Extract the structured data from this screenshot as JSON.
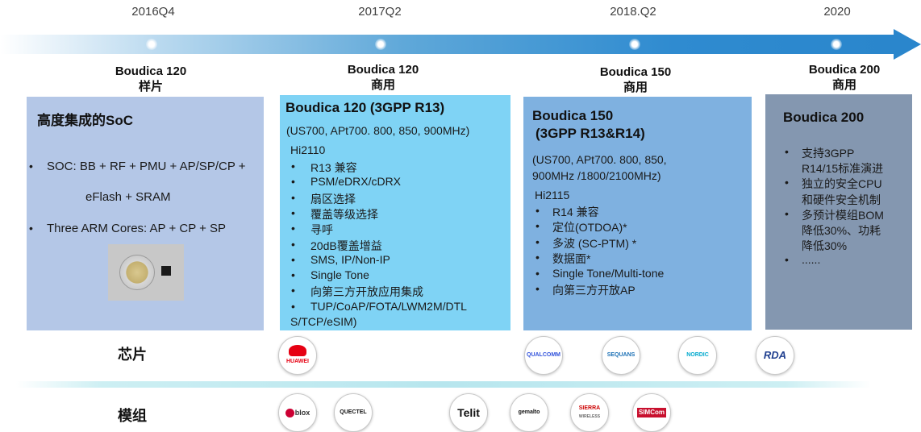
{
  "timeline": {
    "dates": [
      "2016Q4",
      "2017Q2",
      "2018.Q2",
      "2020"
    ],
    "milestones": [
      {
        "name": "Boudica 120",
        "status": "样片"
      },
      {
        "name": "Boudica 120",
        "status": "商用"
      },
      {
        "name": "Boudica 150",
        "status": "商用"
      },
      {
        "name": "Boudica 200",
        "status": "商用"
      }
    ]
  },
  "box1": {
    "title": "高度集成的SoC",
    "bullet_mark": "•",
    "line1": "SOC: BB + RF + PMU + AP/SP/CP +",
    "line2": "eFlash + SRAM",
    "line3": "Three ARM Cores: AP + CP + SP"
  },
  "box2": {
    "title": "Boudica 120 (3GPP R13)",
    "bands": "(US700, APt700. 800, 850, 900MHz)",
    "chip": "Hi2110",
    "bullet_mark": "•",
    "items": [
      "R13 兼容",
      "PSM/eDRX/cDRX",
      "扇区选择",
      "覆盖等级选择",
      "寻呼",
      "20dB覆盖增益",
      "SMS, IP/Non-IP",
      "Single Tone",
      "向第三方开放应用集成",
      "TUP/CoAP/FOTA/LWM2M/DTL"
    ],
    "item_cont": "S/TCP/eSIM)"
  },
  "box3": {
    "title_line1": "Boudica 150",
    "title_line2": "(3GPP R13&R14)",
    "bands_line1": "(US700, APt700. 800, 850,",
    "bands_line2": "900MHz /1800/2100MHz)",
    "chip": "Hi2115",
    "bullet_mark": "•",
    "items": [
      "R14 兼容",
      "定位(OTDOA)*",
      "多波 (SC-PTM) *",
      "数据面*",
      "Single Tone/Multi-tone",
      "向第三方开放AP"
    ]
  },
  "box4": {
    "title": "Boudica 200",
    "bullet_mark": "•",
    "lines": [
      {
        "b": true,
        "text": "支持3GPP"
      },
      {
        "b": false,
        "text": "R14/15标准演进"
      },
      {
        "b": true,
        "text": "独立的安全CPU"
      },
      {
        "b": false,
        "text": "和硬件安全机制"
      },
      {
        "b": true,
        "text": "多预计模组BOM"
      },
      {
        "b": false,
        "text": "降低30%、功耗"
      },
      {
        "b": false,
        "text": "降低30%"
      },
      {
        "b": true,
        "text": "......"
      }
    ]
  },
  "rows": {
    "chip_label": "芯片",
    "module_label": "模组"
  },
  "chip_logos": [
    {
      "icon": "huawei-logo",
      "text": "HUAWEI",
      "color": "#e60012"
    },
    {
      "icon": "qualcomm-logo",
      "text": "QUALCOMM",
      "color": "#3253dc"
    },
    {
      "icon": "sequans-logo",
      "text": "SEQUANS",
      "color": "#1a6fb5"
    },
    {
      "icon": "nordic-logo",
      "text": "NORDIC",
      "color": "#00a9ce"
    },
    {
      "icon": "rda-logo",
      "text": "RDA",
      "color": "#1f3f8f"
    }
  ],
  "module_logos": [
    {
      "icon": "ublox-logo",
      "text": "blox",
      "color": "#cc0033"
    },
    {
      "icon": "quectel-logo",
      "text": "QUECTEL",
      "color": "#111111"
    },
    {
      "icon": "telit-logo",
      "text": "Telit",
      "color": "#111111"
    },
    {
      "icon": "gemalto-logo",
      "text": "gemalto",
      "color": "#111111"
    },
    {
      "icon": "sierra-wireless-logo",
      "text": "SIERRA",
      "subtext": "WIRELESS",
      "color": "#cc0000"
    },
    {
      "icon": "simcom-logo",
      "text": "SIMCom",
      "color": "#c8102e"
    }
  ],
  "colors": {
    "box1": "#b4c7e7",
    "box2": "#7fd3f5",
    "box3": "#7fb1e0",
    "box4": "#8497b0",
    "arrow": "#2a86cc"
  }
}
